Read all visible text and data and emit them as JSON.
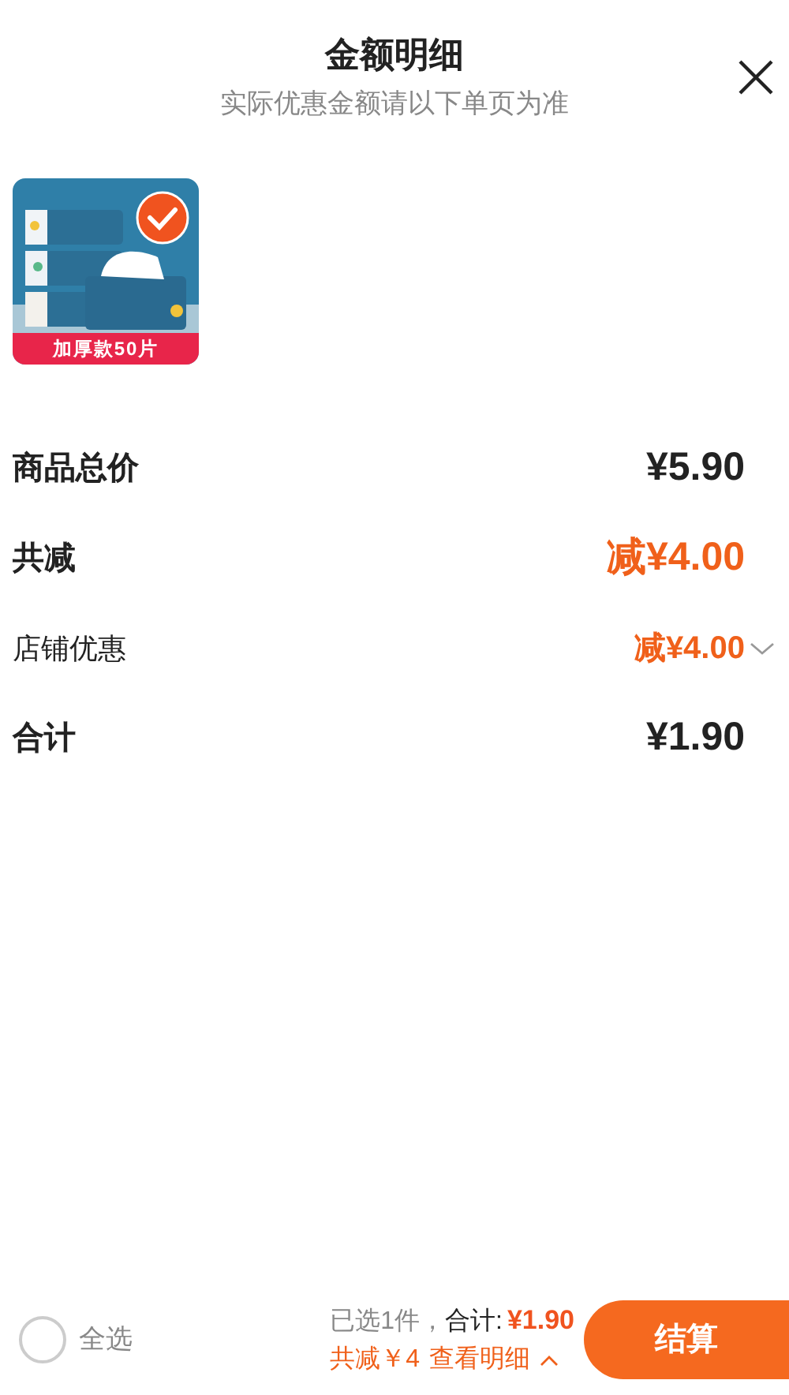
{
  "header": {
    "title": "金额明细",
    "subtitle": "实际优惠金额请以下单页为准"
  },
  "products": [
    {
      "kind": "picture",
      "selected": true,
      "tag": "加厚款50片"
    }
  ],
  "rows": [
    {
      "kind": "main",
      "label": "商品总价",
      "amount": "¥5.90",
      "highlight": false,
      "expandable": false
    },
    {
      "kind": "main",
      "label": "共减",
      "amount": "减¥4.00",
      "highlight": true,
      "expandable": false
    },
    {
      "kind": "sub",
      "label": "店铺优惠",
      "amount": "减¥4.00",
      "highlight": true,
      "expandable": true
    },
    {
      "kind": "main",
      "label": "合计",
      "amount": "¥1.90",
      "highlight": false,
      "expandable": false
    }
  ],
  "footer": {
    "select_all": {
      "label": "全选",
      "checked": false
    },
    "selected_count": "已选1件，",
    "total_label": "合计:",
    "total": "¥1.90",
    "discount": "共减￥4",
    "details_link": "查看明细",
    "checkout": "结算"
  }
}
